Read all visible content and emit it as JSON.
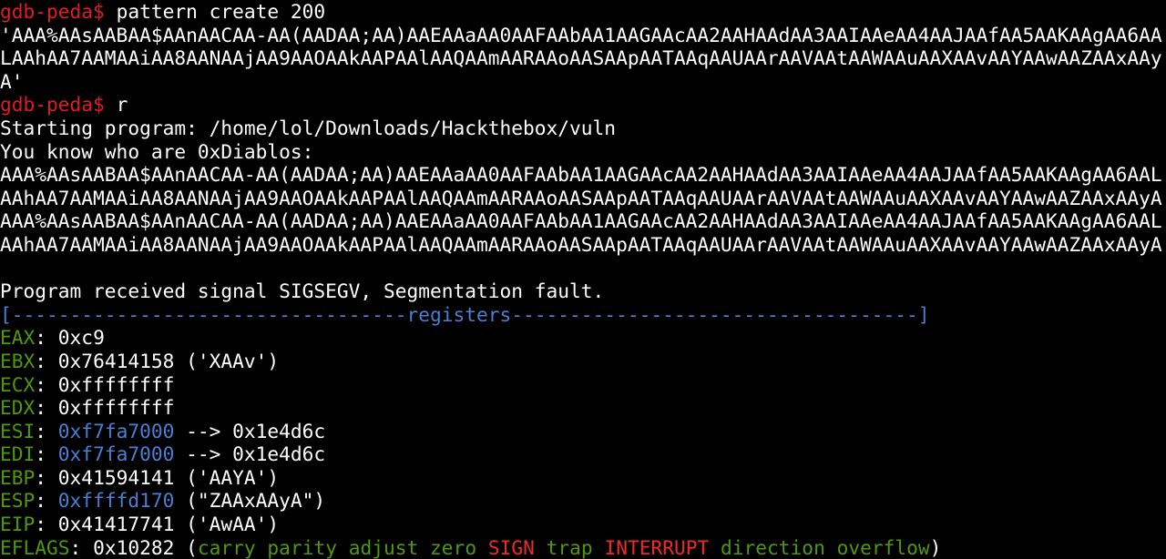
{
  "prompt": "gdb-peda$",
  "commands": {
    "pattern": " pattern create 200",
    "run": " r"
  },
  "pattern_output": [
    "'AAA%AAsAABAA$AAnAACAA-AA(AADAA;AA)AAEAAaAA0AAFAAbAA1AAGAAcAA2AAHAAdAA3AAIAAeAA4AAJAAfAA5AAKAAgAA6AA",
    "LAAhAA7AAMAAiAA8AANAAjAA9AAOAAkAAPAAlAAQAAmAARAAoAASAApAATAAqAAUAArAAVAAtAAWAAuAAXAAvAAYAAwAAZAAxAAy",
    "A'"
  ],
  "program_output": [
    "Starting program: /home/lol/Downloads/Hackthebox/vuln",
    "You know who are 0xDiablos:",
    "AAA%AAsAABAA$AAnAACAA-AA(AADAA;AA)AAEAAaAA0AAFAAbAA1AAGAAcAA2AAHAAdAA3AAIAAeAA4AAJAAfAA5AAKAAgAA6AAL",
    "AAhAA7AAMAAiAA8AANAAjAA9AAOAAkAAPAAlAAQAAmAARAAoAASAApAATAAqAAUAArAAVAAtAAWAAuAAXAAvAAYAAwAAZAAxAAyA",
    "AAA%AAsAABAA$AAnAACAA-AA(AADAA;AA)AAEAAaAA0AAFAAbAA1AAGAAcAA2AAHAAdAA3AAIAAeAA4AAJAAfAA5AAKAAgAA6AAL",
    "AAhAA7AAMAAiAA8AANAAjAA9AAOAAkAAPAAlAAQAAmAARAAoAASAApAATAAqAAUAArAAVAAtAAWAAuAAXAAvAAYAAwAAZAAxAAyA",
    "",
    "Program received signal SIGSEGV, Segmentation fault."
  ],
  "registers_header": "[----------------------------------registers-----------------------------------]",
  "registers": {
    "eax": {
      "name": "EAX",
      "sep": ": ",
      "value": "0xc9",
      "extra": ""
    },
    "ebx": {
      "name": "EBX",
      "sep": ": ",
      "value": "0x76414158",
      "extra": " ('XAAv')"
    },
    "ecx": {
      "name": "ECX",
      "sep": ": ",
      "value": "0xffffffff",
      "extra": ""
    },
    "edx": {
      "name": "EDX",
      "sep": ": ",
      "value": "0xffffffff",
      "extra": ""
    },
    "esi": {
      "name": "ESI",
      "sep": ": ",
      "value": "0xf7fa7000",
      "extra": " --> 0x1e4d6c"
    },
    "edi": {
      "name": "EDI",
      "sep": ": ",
      "value": "0xf7fa7000",
      "extra": " --> 0x1e4d6c"
    },
    "ebp": {
      "name": "EBP",
      "sep": ": ",
      "value": "0x41594141",
      "extra": " ('AAYA')"
    },
    "esp": {
      "name": "ESP",
      "sep": ": ",
      "value": "0xffffd170",
      "extra": " (\"ZAAxAAyA\")"
    },
    "eip": {
      "name": "EIP",
      "sep": ": ",
      "value": "0x41417741",
      "extra": " ('AwAA')"
    }
  },
  "eflags": {
    "name": "EFLAGS",
    "sep": ": ",
    "value": "0x10282",
    "open": " (",
    "flags": [
      "carry",
      "parity",
      "adjust",
      "zero",
      "SIGN",
      "trap",
      "INTERRUPT",
      "direction",
      "overflow"
    ],
    "close": ")"
  },
  "colors": {
    "background": "#000000",
    "prompt": "#e01b24",
    "text": "#ffffff",
    "register_name": "#4e9a06",
    "pointer_value": "#4a7fd4",
    "flag_off": "#4e9a06",
    "flag_on": "#ef2929"
  }
}
